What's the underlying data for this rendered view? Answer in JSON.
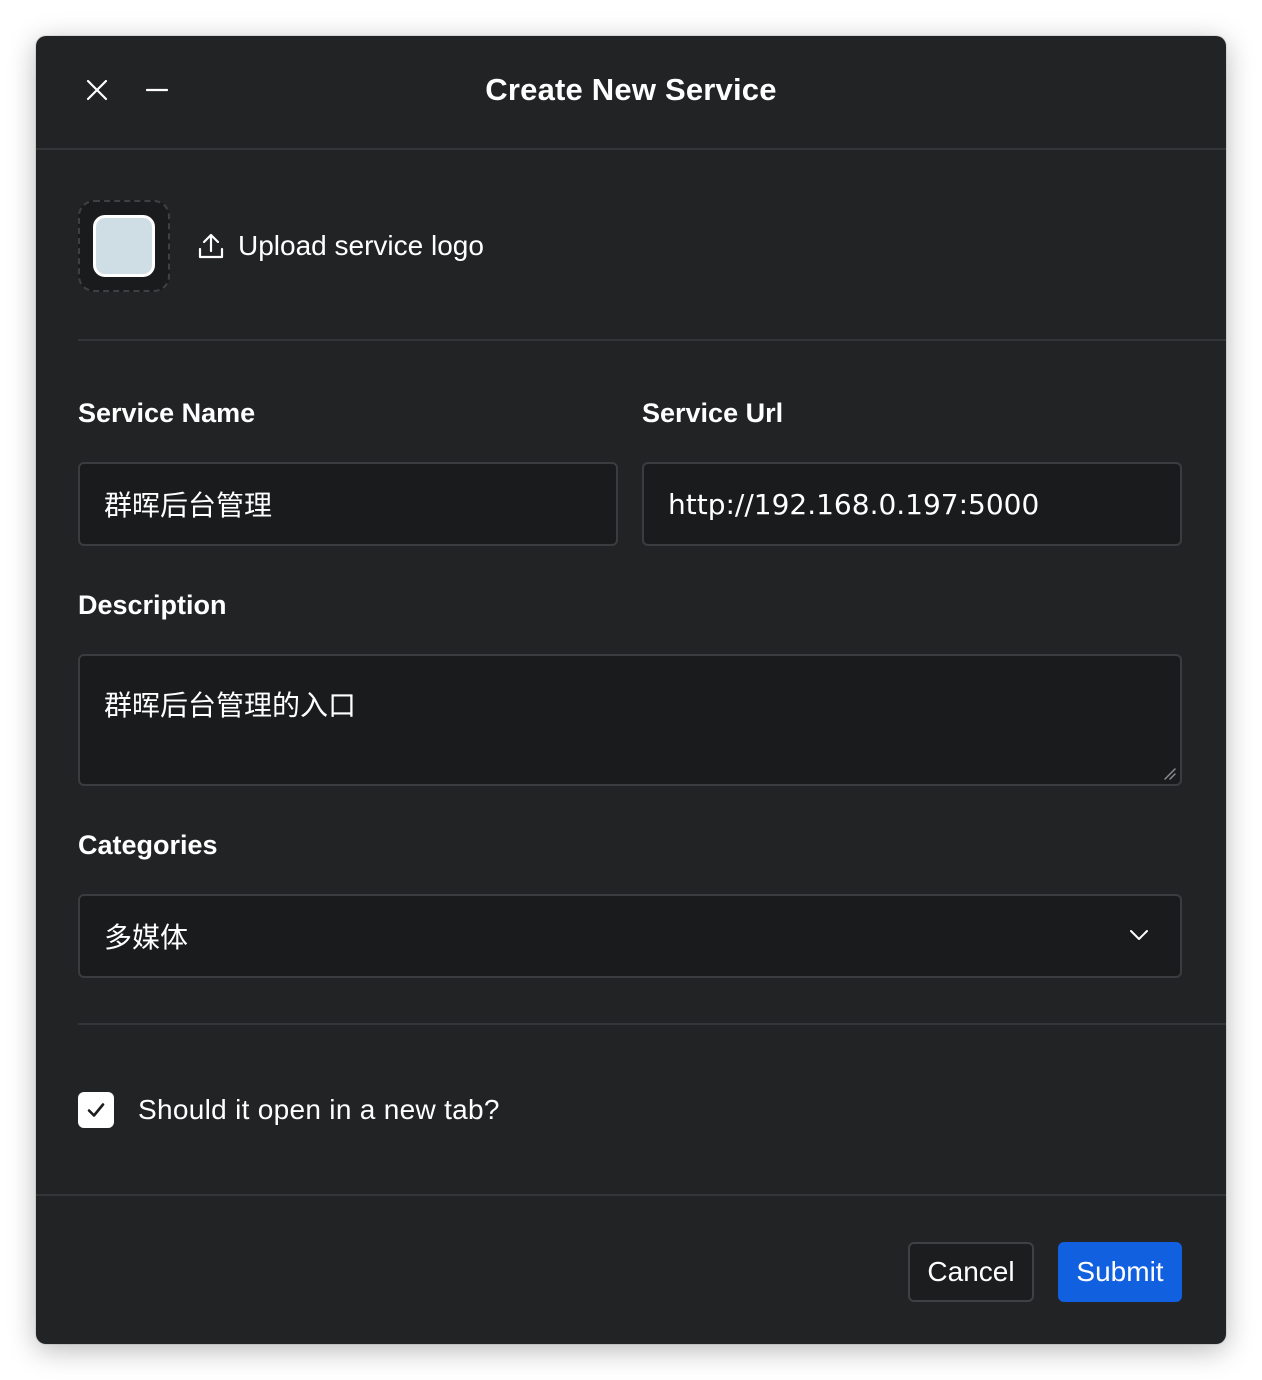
{
  "dialog": {
    "title": "Create New Service",
    "close_icon": "close-icon",
    "minimize_icon": "minimize-icon"
  },
  "logo": {
    "upload_label": "Upload service logo",
    "upload_icon": "upload-icon"
  },
  "form": {
    "service_name": {
      "label": "Service Name",
      "value": "群晖后台管理"
    },
    "service_url": {
      "label": "Service Url",
      "value": "http://192.168.0.197:5000"
    },
    "description": {
      "label": "Description",
      "value": "群晖后台管理的入口"
    },
    "categories": {
      "label": "Categories",
      "selected": "多媒体",
      "chevron_icon": "chevron-down-icon"
    },
    "new_tab": {
      "label": "Should it open in a new tab?",
      "checked": true
    }
  },
  "footer": {
    "cancel_label": "Cancel",
    "submit_label": "Submit"
  },
  "colors": {
    "dialog_bg": "#222325",
    "field_bg": "#1a1b1d",
    "accent": "#1160e0",
    "text": "#ffffff"
  }
}
